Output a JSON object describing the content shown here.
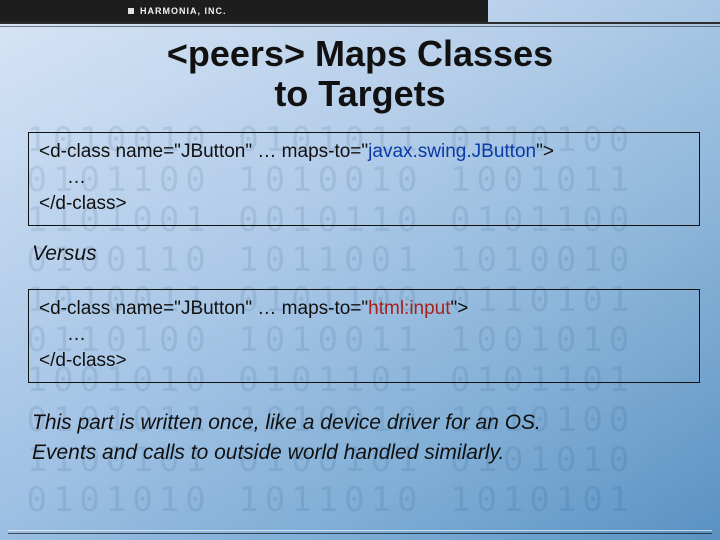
{
  "header": {
    "company": "HARMONIA, INC."
  },
  "title": {
    "line1": "<peers> Maps Classes",
    "line2": "to Targets"
  },
  "code1": {
    "open_prefix": "<d-class name=\"",
    "name_val": "JButton",
    "mid": "\" … maps-to=\"",
    "target": "javax.swing.JButton",
    "open_suffix": "\">",
    "body": "…",
    "close": "</d-class>"
  },
  "versus": "Versus",
  "code2": {
    "open_prefix": "<d-class name=\"",
    "name_val": "JButton",
    "mid": "\" … maps-to=\"",
    "target": "html:input",
    "open_suffix": "\">",
    "body": "…",
    "close": "</d-class>"
  },
  "footnote": {
    "line1": "This part is written once, like a device driver for an OS.",
    "line2": "Events and calls to outside world handled similarly."
  },
  "bgdigits": " 1010010 0101011 0110100\n 0101100 1010010 1001011\n 1101001 0010110 0101100\n 0100110 1011001 1010010\n 1010011 0101100 0110101\n 0110100 1010011 1001010\n 1001010 0101101 0101101\n 0101011 1010010 1010100\n 1100101 0100101 0101010\n 0101010 1011010 1010101"
}
